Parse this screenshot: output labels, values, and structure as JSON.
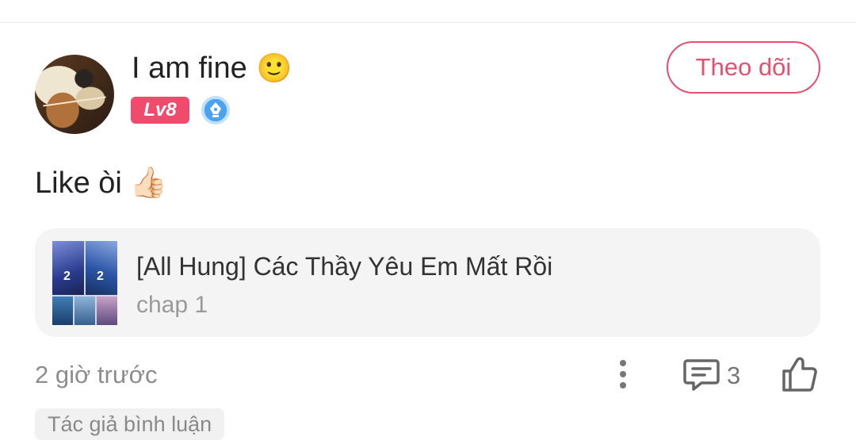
{
  "user": {
    "name": "I am fine",
    "name_emoji": "🙂",
    "level": "Lv8",
    "badge_icon": "pen-nib-icon"
  },
  "follow_label": "Theo dõi",
  "comment": {
    "text": "Like òi",
    "emoji": "👍🏻"
  },
  "story": {
    "title": "[All Hung] Các Thầy Yêu Em Mất Rồi",
    "chapter": "chap 1"
  },
  "meta": {
    "time": "2 giờ trước",
    "comment_count": "3",
    "author_tag": "Tác giả bình luận"
  },
  "colors": {
    "accent": "#e5506f",
    "level_badge": "#f04b6c",
    "muted_text": "#8d8d8d"
  }
}
